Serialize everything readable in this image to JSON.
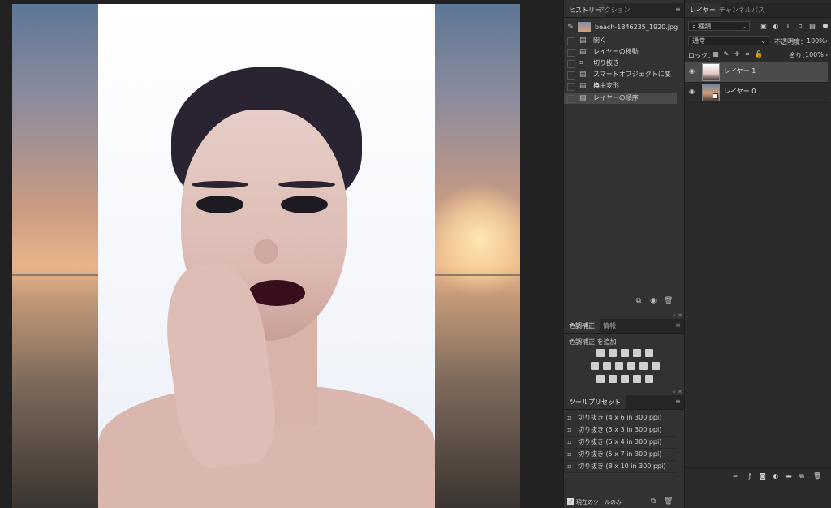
{
  "history_panel": {
    "tabs": [
      {
        "label": "ヒストリー"
      },
      {
        "label": "アクション"
      }
    ],
    "snapshot": {
      "label": "beach-1846235_1920.jpg"
    },
    "items": [
      {
        "label": "開く",
        "icon": "document-icon"
      },
      {
        "label": "レイヤーの移動",
        "icon": "document-icon"
      },
      {
        "label": "切り抜き",
        "icon": "crop-icon"
      },
      {
        "label": "スマートオブジェクトに変換",
        "icon": "document-icon"
      },
      {
        "label": "自由変形",
        "icon": "document-icon"
      },
      {
        "label": "レイヤーの順序",
        "icon": "document-icon",
        "selected": true
      }
    ]
  },
  "adjustments_panel": {
    "tabs": [
      {
        "label": "色調補正"
      },
      {
        "label": "情報"
      }
    ],
    "add_label": "色調補正 を追加"
  },
  "tool_presets_panel": {
    "tabs": [
      {
        "label": "ツールプリセット"
      }
    ],
    "items": [
      {
        "label": "切り抜き (4 x 6 in 300 ppi)"
      },
      {
        "label": "切り抜き (5 x 3 in 300 ppi)"
      },
      {
        "label": "切り抜き (5 x 4 in 300 ppi)"
      },
      {
        "label": "切り抜き (5 x 7 in 300 ppi)"
      },
      {
        "label": "切り抜き (8 x 10 in 300 ppi)"
      }
    ],
    "current_tool_only_label": "現在のツールのみ"
  },
  "layers_panel": {
    "tabs": [
      {
        "label": "レイヤー"
      },
      {
        "label": "チャンネル"
      },
      {
        "label": "パス"
      }
    ],
    "filter_kind": "種類",
    "blend_mode": "通常",
    "opacity_label": "不透明度：",
    "opacity_value": "100%",
    "lock_label": "ロック：",
    "fill_label": "塗り：",
    "fill_value": "100%",
    "layers": [
      {
        "name": "レイヤー 1",
        "visible": true,
        "selected": true
      },
      {
        "name": "レイヤー 0",
        "visible": true,
        "selected": false
      }
    ],
    "footer_icons": [
      "link-icon",
      "fx-icon",
      "mask-icon",
      "adjustment-icon",
      "folder-icon",
      "new-layer-icon",
      "trash-icon"
    ]
  }
}
